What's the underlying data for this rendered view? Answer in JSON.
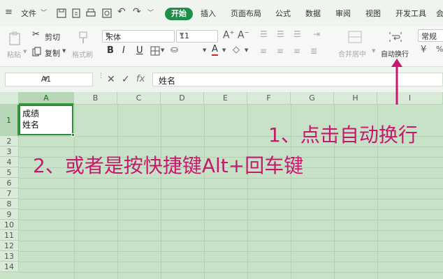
{
  "menubar": {
    "file_menu": "文件",
    "tabs": [
      {
        "label": "开始",
        "active": true
      },
      {
        "label": "插入",
        "active": false
      },
      {
        "label": "页面布局",
        "active": false
      },
      {
        "label": "公式",
        "active": false
      },
      {
        "label": "数据",
        "active": false
      },
      {
        "label": "审阅",
        "active": false
      },
      {
        "label": "视图",
        "active": false
      },
      {
        "label": "开发工具",
        "active": false
      }
    ],
    "more": "会"
  },
  "toolbar": {
    "paste": "粘贴",
    "cut": "剪切",
    "copy": "复制",
    "format_painter": "格式刷",
    "font_name": "宋体",
    "font_size": "11",
    "merge_center": "合并居中",
    "wrap_text": "自动换行",
    "number_format": "常规",
    "bold": "B",
    "italic": "I",
    "underline": "U"
  },
  "formula_bar": {
    "cell_ref": "A1",
    "formula": "姓名"
  },
  "grid": {
    "columns": [
      "A",
      "B",
      "C",
      "D",
      "E",
      "F",
      "G",
      "H",
      "I"
    ],
    "rows": [
      "1",
      "2",
      "3",
      "4",
      "5",
      "6",
      "7",
      "8",
      "9",
      "10",
      "11",
      "12",
      "13",
      "14"
    ],
    "cell_A1": {
      "line1": "成绩",
      "line2": "姓名"
    }
  },
  "annotations": {
    "step1": "1、点击自动换行",
    "step2": "2、或者是按快捷键Alt+回车键"
  },
  "colors": {
    "accent": "#1e8f4a",
    "annotation": "#c4196d",
    "grid_bg": "#c8e2c8"
  }
}
